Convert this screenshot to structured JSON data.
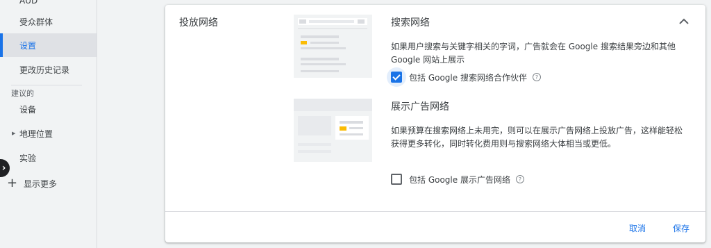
{
  "sidebar": {
    "cut_item": "AUD",
    "items": [
      {
        "label": "受众群体"
      },
      {
        "label": "设置"
      },
      {
        "label": "更改历史记录"
      }
    ],
    "group_label": "建议的",
    "group_items": [
      {
        "label": "设备"
      },
      {
        "label": "地理位置"
      },
      {
        "label": "实验"
      }
    ],
    "show_more": "显示更多",
    "active_color": "#1a73e8"
  },
  "card": {
    "section_label": "投放网络",
    "search": {
      "title": "搜索网络",
      "description": "如果用户搜索与关键字相关的字词，广告就会在 Google 搜索结果旁边和其他 Google 网站上展示",
      "checkbox_label": "包括 Google 搜索网络合作伙伴",
      "checked": true
    },
    "display": {
      "title": "展示广告网络",
      "description": "如果预算在搜索网络上未用完，则可以在展示广告网络上投放广告，这样能轻松获得更多转化，同时转化费用则与搜索网络大体相当或更低。",
      "checkbox_label": "包括 Google 展示广告网络",
      "checked": false
    },
    "icons": {
      "collapse": "chevron-up-icon",
      "help": "help-circle-icon"
    },
    "footer": {
      "cancel": "取消",
      "save": "保存"
    }
  }
}
